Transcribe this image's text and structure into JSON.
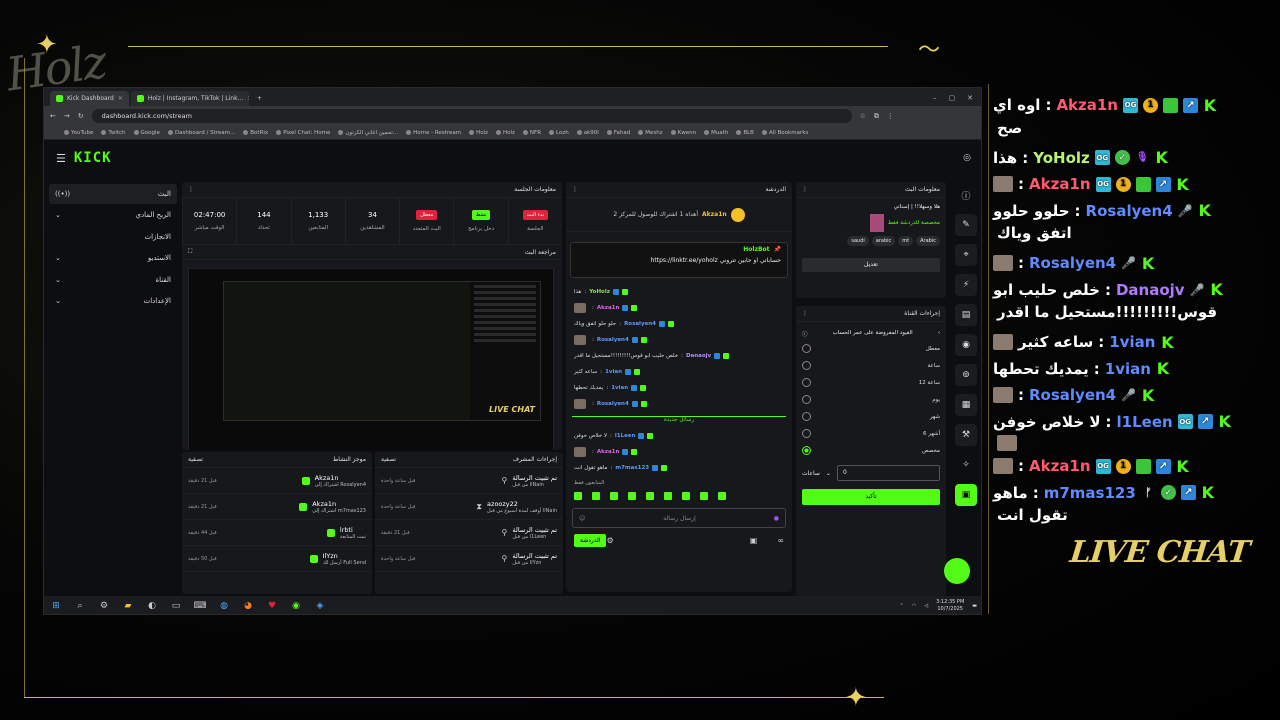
{
  "overlay": {
    "brand": "Holz",
    "live_chat": "LIVE CHAT"
  },
  "browser": {
    "tabs": [
      {
        "title": "Kick Dashboard"
      },
      {
        "title": "Holz | Instagram, TikTok | Link..."
      }
    ],
    "url": "dashboard.kick.com/stream",
    "bookmarks": [
      "YouTube",
      "Twitch",
      "Google",
      "Dashboard / Stream...",
      "BotRix",
      "Pixel Chat: Home",
      "تحمين اغاني الكرتون...",
      "Home - Restream",
      "Holz",
      "Holz",
      "NFR",
      "Lozh",
      "ak90l",
      "Fahad",
      "Meshz",
      "Kwenn",
      "Muath",
      "BLB",
      "All Bookmarks"
    ]
  },
  "kick": {
    "logo": "KICK",
    "sidebar": [
      {
        "label": "البث"
      },
      {
        "label": "الربح المادي"
      },
      {
        "label": "الانجازات"
      },
      {
        "label": "الاستديو"
      },
      {
        "label": "القناة"
      },
      {
        "label": "الإعدادات"
      }
    ],
    "session": {
      "title": "معلومات الجلسة",
      "stats": [
        {
          "value": "02:47:00",
          "label": "الوقت مباشر"
        },
        {
          "value": "144",
          "label": "تحداد"
        },
        {
          "value": "1,133",
          "label": "المتابعين"
        },
        {
          "value": "34",
          "label": "المشاهدين"
        },
        {
          "value": "معطل",
          "label": "البث المتعدد"
        },
        {
          "value": "نشط",
          "label": "دخل برنامج"
        },
        {
          "value": "بدء البث",
          "label": "الجلسة"
        }
      ]
    },
    "preview": {
      "title": "مراجعة البث",
      "overlay_text": "LIVE CHAT"
    },
    "activity": {
      "title": "موجز النشاط",
      "filter": "تصفية",
      "items": [
        {
          "name": "Akza1n",
          "sub": "اشتراك إلى Rosalyen4",
          "time": "قبل 21 دقيقة"
        },
        {
          "name": "Akza1n",
          "sub": "اشتراك إلى m7mas123",
          "time": "قبل 21 دقيقة"
        },
        {
          "name": "lrbti",
          "sub": "تمت المتابعة",
          "time": "قبل 44 دقيقة"
        },
        {
          "name": "IlYzn",
          "sub": "أرسل لك Full Send",
          "time": "قبل 50 دقيقة"
        }
      ]
    },
    "mod": {
      "title": "إجراءات المشرف",
      "filter": "تصفية",
      "items": [
        {
          "name": "تم تثبيت الرسالة",
          "sub": "من قبل llNain",
          "time": "قبل ساعة واحدة"
        },
        {
          "name": "azoozy22",
          "sub": "أوقف لمدة أسبوع من قبل llNain",
          "time": "قبل ساعة واحدة"
        },
        {
          "name": "تم تثبيت الرسالة",
          "sub": "من قبل l1Leen",
          "time": "قبل 21 دقيقة"
        },
        {
          "name": "تم تثبيت الرسالة",
          "sub": "من قبل IlYzn",
          "time": "قبل ساعة واحدة"
        }
      ]
    },
    "chat": {
      "title": "الدردشة",
      "top_user": "Akza1n",
      "top_text": "أهداه 1 اشتراك للوصول للمركز 2",
      "pinned_user": "HolzBot",
      "pinned_text": "حساباتي او حابين تتروني https://linktr.ee/yoholz",
      "messages": [
        {
          "user": "YoHolz",
          "text": "هذا",
          "color": "#8fe05a"
        },
        {
          "user": "Akza1n",
          "text": "",
          "color": "#e060e0"
        },
        {
          "user": "Rosalyen4",
          "text": "حلو حلو اتفق وياك",
          "color": "#5b9bff"
        },
        {
          "user": "Rosalyen4",
          "text": "",
          "color": "#5b9bff"
        },
        {
          "user": "Danaojv",
          "text": "خلص حليب ابو قوس!!!!!!!!!مستحيل ما اقدر",
          "color": "#b58cff"
        },
        {
          "user": "1vian",
          "text": "ساعه كثير",
          "color": "#5b9bff"
        },
        {
          "user": "1vian",
          "text": "يمديك تحطها",
          "color": "#5b9bff"
        },
        {
          "user": "Rosalyen4",
          "text": "",
          "color": "#5b9bff"
        }
      ],
      "new_messages": "رسائل جديدة",
      "messages2": [
        {
          "user": "l1Leen",
          "text": "لا خلاص خوفن",
          "color": "#5b9bff"
        },
        {
          "user": "Akza1n",
          "text": "",
          "color": "#e060e0"
        },
        {
          "user": "m7mas123",
          "text": "ماهو تقول انت",
          "color": "#5b9bff"
        }
      ],
      "followers_only": "المتابعون فقط",
      "input_placeholder": "إرسال رسالة",
      "send": "الدردشة"
    },
    "stream_info": {
      "title": "معلومات البث",
      "desc": "هلا وسهلا!! | إسناتي",
      "category": "مخصصة للدردشة فقط",
      "tags": [
        "Arabic",
        "mt",
        "arabic",
        "saudi"
      ],
      "edit": "تعديل"
    },
    "channel_actions": {
      "title": "إجراءات القناة",
      "subtitle": "القيود المفروضة على عمر الحساب",
      "options": [
        "معطل",
        "ساعة",
        "12 ساعة",
        "يوم",
        "شهر",
        "6 أشهر",
        "مخصص"
      ],
      "selected": 6,
      "input_value": "0",
      "unit": "ساعات",
      "confirm": "تأكيد"
    },
    "clock": {
      "time": "3:12:35 PM",
      "date": "10/7/2025"
    }
  },
  "live_chat": [
    {
      "badges": [
        "k",
        "up",
        "cube",
        "num",
        "og"
      ],
      "user": "Akza1n",
      "user_color": "#ff5a6e",
      "text": "اوه اي",
      "wrap": "صح"
    },
    {
      "badges": [
        "k",
        "mic",
        "chk",
        "og"
      ],
      "user": "YoHolz",
      "user_color": "#b8f27a",
      "text": "هذا"
    },
    {
      "badges": [
        "k",
        "up",
        "cube",
        "num",
        "og"
      ],
      "user": "Akza1n",
      "user_color": "#ff5a6e",
      "text": "",
      "emote": true
    },
    {
      "badges": [
        "k",
        "fl"
      ],
      "user": "Rosalyen4",
      "user_color": "#5f8bff",
      "text": "حلوو حلوو",
      "wrap": "اتفق وياك"
    },
    {
      "badges": [
        "k",
        "fl"
      ],
      "user": "Rosalyen4",
      "user_color": "#5f8bff",
      "text": "",
      "emote": true
    },
    {
      "badges": [
        "k",
        "fl"
      ],
      "user": "Danaojv",
      "user_color": "#b07cff",
      "text": "خلص حليب ابو",
      "wrap": "قوس!!!!!!!!!مستحيل ما اقدر"
    },
    {
      "badges": [
        "k"
      ],
      "user": "1vian",
      "user_color": "#5f8bff",
      "text": "ساعه كثير",
      "emote": true
    },
    {
      "badges": [
        "k"
      ],
      "user": "1vian",
      "user_color": "#5f8bff",
      "text": "يمديك تحطها"
    },
    {
      "badges": [
        "k",
        "fl"
      ],
      "user": "Rosalyen4",
      "user_color": "#5f8bff",
      "text": "",
      "emote": true
    },
    {
      "badges": [
        "k",
        "up",
        "og"
      ],
      "user": "l1Leen",
      "user_color": "#5f8bff",
      "text": "لا خلاص خوفن",
      "emote_below": true
    },
    {
      "badges": [
        "k",
        "up",
        "cube",
        "num",
        "og"
      ],
      "user": "Akza1n",
      "user_color": "#ff5a6e",
      "text": "",
      "emote": true
    },
    {
      "badges": [
        "k",
        "up",
        "chk",
        "kn"
      ],
      "user": "m7mas123",
      "user_color": "#5f8bff",
      "text": "ماهو",
      "wrap": "تقول انت"
    }
  ]
}
